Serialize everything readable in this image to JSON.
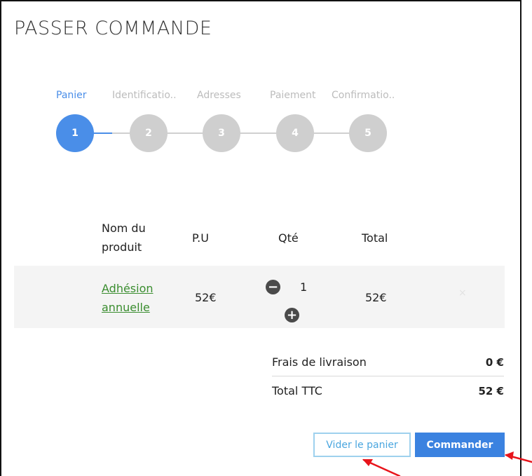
{
  "page": {
    "title": "PASSER COMMANDE"
  },
  "steps": [
    {
      "label": "Panier",
      "number": "1",
      "active": true
    },
    {
      "label": "Identificatio..",
      "number": "2",
      "active": false
    },
    {
      "label": "Adresses",
      "number": "3",
      "active": false
    },
    {
      "label": "Paiement",
      "number": "4",
      "active": false
    },
    {
      "label": "Confirmatio..",
      "number": "5",
      "active": false
    }
  ],
  "table": {
    "headers": {
      "product_line1": "Nom du",
      "product_line2": "produit",
      "unit_price": "P.U",
      "qty": "Qté",
      "total": "Total"
    },
    "rows": [
      {
        "product_line1": "Adhésion",
        "product_line2": "annuelle",
        "unit_price": "52€",
        "qty": "1",
        "total": "52€",
        "remove": "×"
      }
    ]
  },
  "summary": {
    "shipping_label": "Frais de livraison",
    "shipping_value": "0 €",
    "total_label": "Total TTC",
    "total_value": "52 €"
  },
  "actions": {
    "clear_label": "Vider le panier",
    "order_label": "Commander"
  },
  "colors": {
    "accent": "#4a8ee8",
    "inactive_step": "#cfcfcf",
    "link": "#3a8d2f",
    "order_button": "#3b82e0",
    "annotation_arrow": "#e8141b"
  },
  "icons": {
    "minus": "minus-circle-icon",
    "plus": "plus-circle-icon",
    "remove": "close-icon"
  }
}
